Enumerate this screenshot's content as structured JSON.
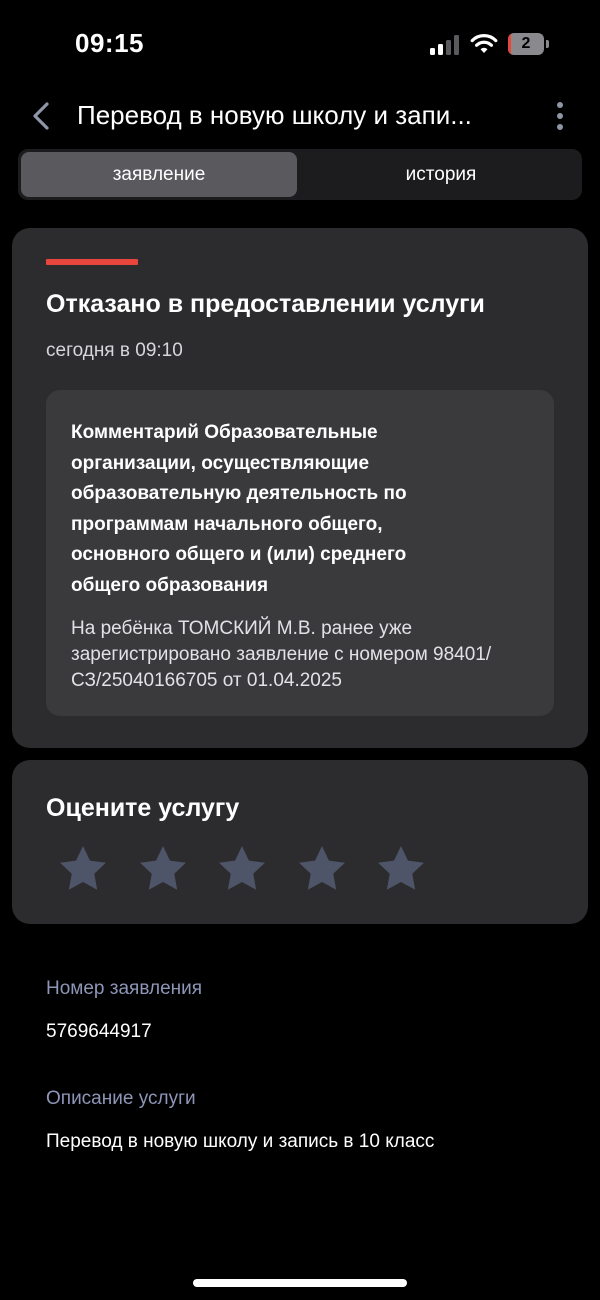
{
  "status_bar": {
    "time": "09:15",
    "battery_level": "2",
    "battery_fill_percent": 8,
    "battery_color": "#e8453c"
  },
  "header": {
    "title": "Перевод в новую школу и запи...",
    "back_icon": "chevron-left-icon",
    "more_icon": "more-vertical-icon"
  },
  "tabs": [
    {
      "label": "заявление",
      "active": true
    },
    {
      "label": "история",
      "active": false
    }
  ],
  "status_card": {
    "accent_color": "#e8453c",
    "title": "Отказано в предоставлении услуги",
    "date": "сегодня в 09:10",
    "comment": {
      "title": "Комментарий Образовательные организации, осуществляющие образовательную деятельность по программам начального общего, основного общего и (или) среднего общего образования",
      "text": "На ребёнка ТОМСКИЙ М.В. ранее уже зарегистрировано заявление с номером 98401/СЗ/25040166705 от 01.04.2025"
    }
  },
  "rating": {
    "title": "Оцените услугу",
    "max_stars": 5,
    "selected": 0,
    "star_color": "#4e5568"
  },
  "info": {
    "application_number_label": "Номер заявления",
    "application_number": "5769644917",
    "service_description_label": "Описание услуги",
    "service_description": "Перевод в новую школу и запись в 10 класс"
  }
}
